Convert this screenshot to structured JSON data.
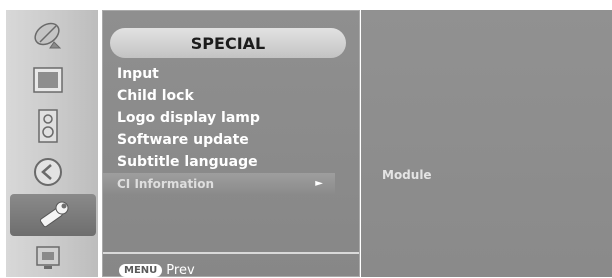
{
  "rail": {
    "icons": [
      "satellite-dish-icon",
      "picture-icon",
      "audio-speaker-icon",
      "time-clock-icon",
      "special-wrench-icon",
      "screen-icon"
    ],
    "active_index": 4
  },
  "menu": {
    "title": "SPECIAL",
    "items": [
      {
        "label": "Input"
      },
      {
        "label": "Child lock"
      },
      {
        "label": "Logo display lamp"
      },
      {
        "label": "Software update"
      },
      {
        "label": "Subtitle language"
      },
      {
        "label": "CI Information",
        "arrow": "►"
      }
    ],
    "selected_index": 5,
    "footer": {
      "key": "MENU",
      "label": "Prev"
    }
  },
  "submenu": {
    "items": [
      {
        "label": "Module"
      }
    ]
  },
  "colors": {
    "panel": "#8a8a8a",
    "rail_active": "#707070",
    "text": "#ffffff"
  }
}
